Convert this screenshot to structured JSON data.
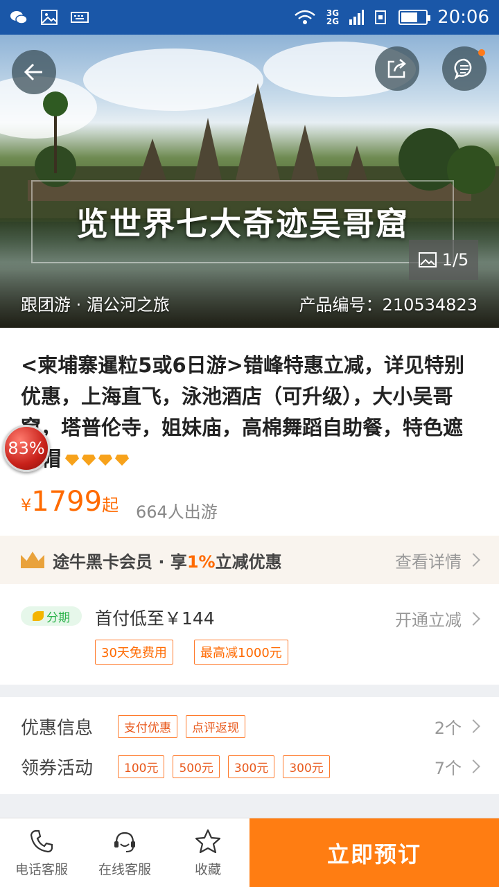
{
  "status_bar": {
    "network_top": "3G",
    "network_bottom": "2G",
    "time": "20:06"
  },
  "hero": {
    "banner_text": "览世界七大奇迹吴哥窟",
    "image_counter": "1/5",
    "tour_type": "跟团游 · 湄公河之旅",
    "product_no": "产品编号：210534823"
  },
  "product": {
    "title": "<柬埔寨暹粒5或6日游>错峰特惠立减，详见特别优惠，上海直飞，泳池酒店（可升级），大小吴哥窟，塔普伦寺，姐妹庙，高棉舞蹈自助餐，特色遮阳帽",
    "rating_badge": "83%",
    "price_currency": "¥",
    "price_value": "1799",
    "price_suffix": "起",
    "travelers": "664人出游",
    "gem_count": 4
  },
  "member": {
    "text_prefix": "途牛黑卡会员 · 享",
    "text_pct": "1%",
    "text_suffix": "立减优惠",
    "link": "查看详情"
  },
  "installment": {
    "badge": "分期",
    "first_pay": "首付低至￥144",
    "link": "开通立减",
    "tags": [
      "30天免费用",
      "最高减1000元"
    ]
  },
  "offers": {
    "discount_label": "优惠信息",
    "discount_tags": [
      "支付优惠",
      "点评返现"
    ],
    "discount_count": "2个",
    "coupon_label": "领券活动",
    "coupon_tags": [
      "100元",
      "500元",
      "300元",
      "300元"
    ],
    "coupon_count": "7个"
  },
  "bottom_bar": {
    "phone": "电话客服",
    "online": "在线客服",
    "favorite": "收藏",
    "book": "立即预订"
  },
  "colors": {
    "accent": "#ff7d12",
    "status_bar": "#1a57a8",
    "price": "#ff6a00"
  }
}
